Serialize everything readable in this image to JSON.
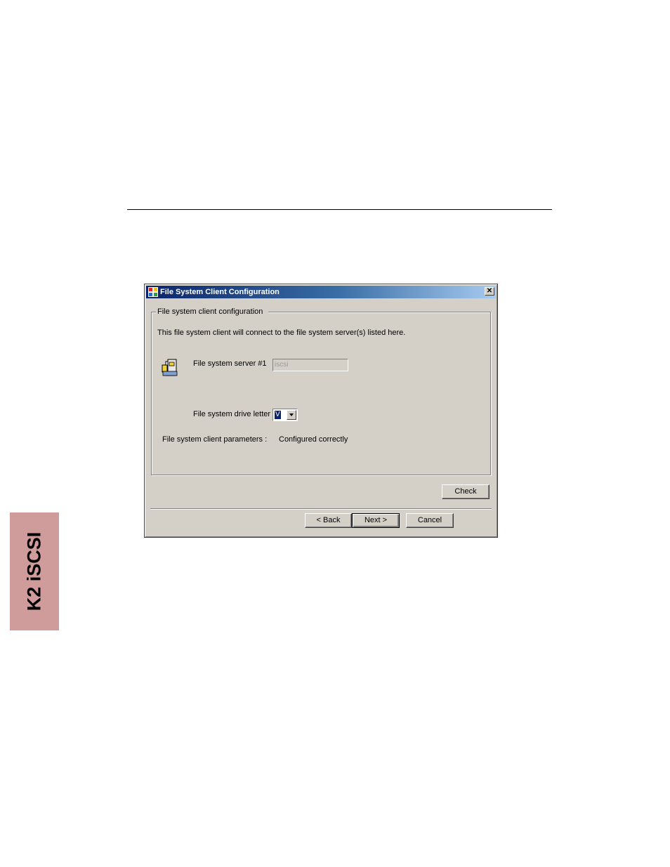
{
  "side_tab": {
    "label": "K2 iSCSI"
  },
  "dialog": {
    "title": "File System Client Configuration",
    "close_glyph": "✕",
    "icons": {
      "app": "window-app-icon",
      "server": "server-icon"
    },
    "group": {
      "legend": "File system client configuration",
      "description": "This file system client will connect to the file system server(s) listed here.",
      "server_label": "File system server #1",
      "server_value": "iscsi",
      "drive_label": "File system drive letter",
      "drive_value": "V",
      "params_label": "File system client parameters :",
      "params_value": "Configured correctly"
    },
    "buttons": {
      "check": "Check",
      "back": "< Back",
      "next": "Next >",
      "cancel": "Cancel"
    }
  },
  "colors": {
    "title_gradient_start": "#0a246a",
    "title_gradient_end": "#a6caf0",
    "dialog_face": "#d4d0c8",
    "side_tab": "#cf9b9b"
  }
}
